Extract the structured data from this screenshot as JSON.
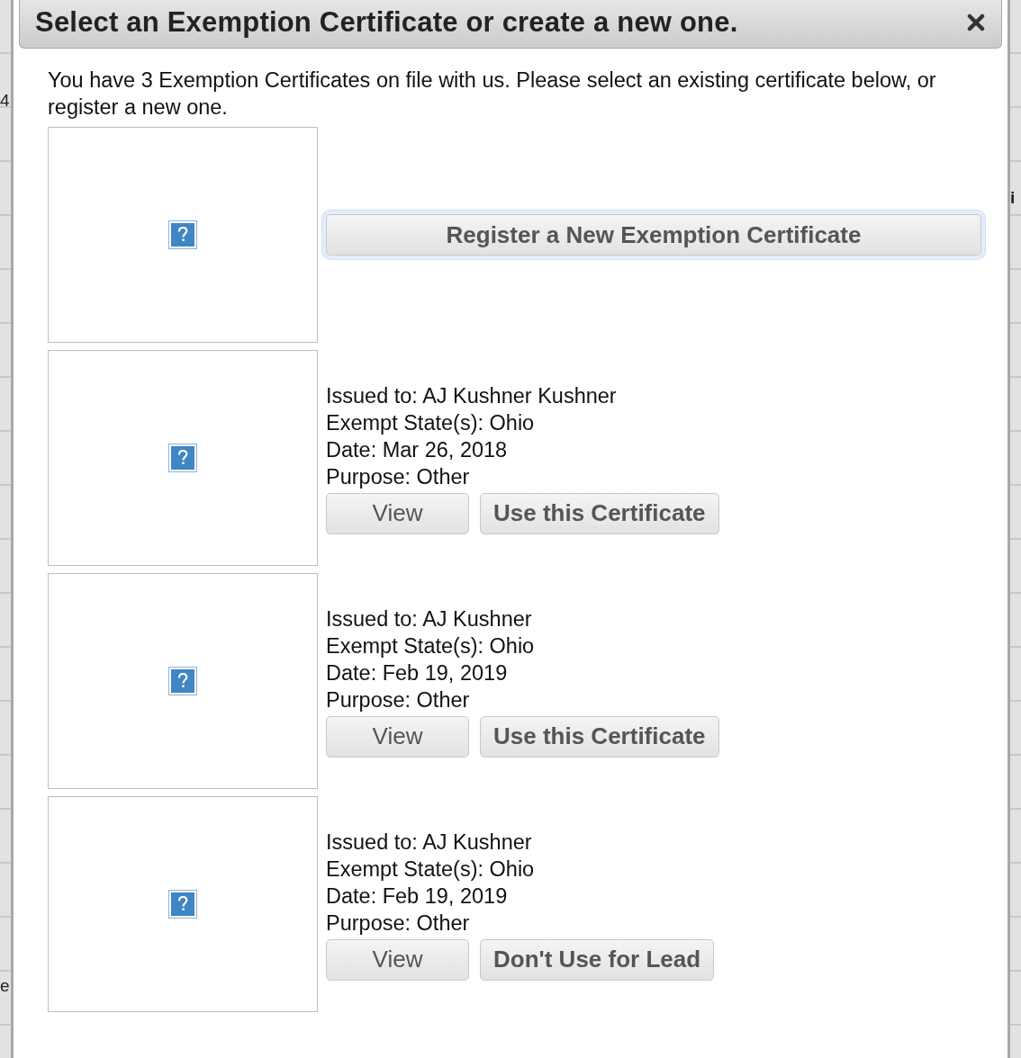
{
  "backdrop": {
    "left_fragments": [
      "4",
      "e"
    ],
    "right_fragments": [
      "i"
    ]
  },
  "dialog": {
    "title": "Select an Exemption Certificate or create a new one.",
    "intro": "You have 3 Exemption Certificates on file with us. Please select an existing certificate below, or register a new one.",
    "rows": [
      {
        "kind": "register",
        "button": {
          "label": "Register a New Exemption Certificate",
          "focused": true
        }
      },
      {
        "kind": "certificate",
        "lines": [
          "Issued to: AJ Kushner Kushner",
          "Exempt State(s): Ohio",
          "Date: Mar 26, 2018",
          "Purpose: Other"
        ],
        "buttons": [
          {
            "label": "View",
            "bold": false
          },
          {
            "label": "Use this Certificate",
            "bold": true
          }
        ]
      },
      {
        "kind": "certificate",
        "lines": [
          "Issued to: AJ Kushner",
          "Exempt State(s): Ohio",
          "Date: Feb 19, 2019",
          "Purpose: Other"
        ],
        "buttons": [
          {
            "label": "View",
            "bold": false
          },
          {
            "label": "Use this Certificate",
            "bold": true
          }
        ]
      },
      {
        "kind": "certificate",
        "lines": [
          "Issued to: AJ Kushner",
          "Exempt State(s): Ohio",
          "Date: Feb 19, 2019",
          "Purpose: Other"
        ],
        "buttons": [
          {
            "label": "View",
            "bold": false
          },
          {
            "label": "Don't Use for Lead",
            "bold": true
          }
        ]
      }
    ]
  }
}
